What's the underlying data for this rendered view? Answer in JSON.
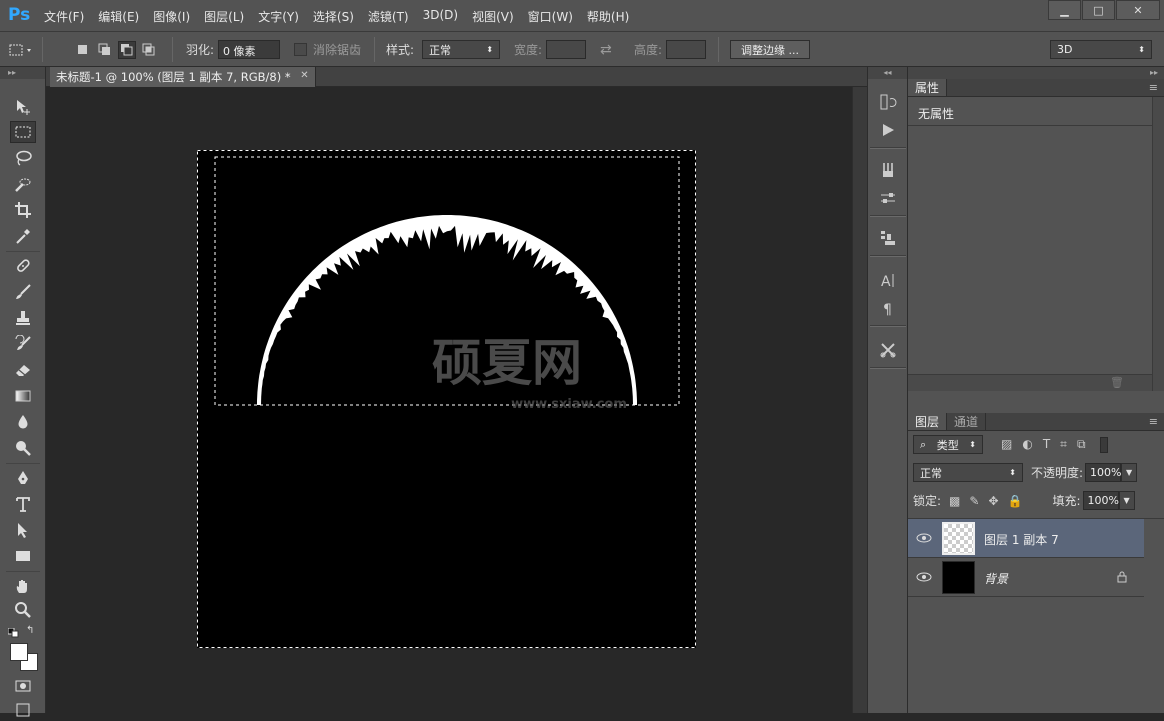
{
  "menubar": {
    "logo": "Ps",
    "items": [
      "文件(F)",
      "编辑(E)",
      "图像(I)",
      "图层(L)",
      "文字(Y)",
      "选择(S)",
      "滤镜(T)",
      "3D(D)",
      "视图(V)",
      "窗口(W)",
      "帮助(H)"
    ],
    "window_controls": [
      "minimize",
      "maximize",
      "close"
    ]
  },
  "options_bar": {
    "feather_label": "羽化:",
    "feather_value": "0 像素",
    "antialias_label": "消除锯齿",
    "style_label": "样式:",
    "style_value": "正常",
    "width_label": "宽度:",
    "height_label": "高度:",
    "refine_edge_button": "调整边缘 ...",
    "workspace_value": "3D"
  },
  "document": {
    "tab_title": "未标题-1 @ 100% (图层 1 副本 7, RGB/8) *"
  },
  "properties_panel": {
    "tab_label": "属性",
    "content": "无属性"
  },
  "layers_panel": {
    "tabs": [
      "图层",
      "通道"
    ],
    "filter_label": "类型",
    "blend_mode": "正常",
    "opacity_label": "不透明度:",
    "opacity_value": "100%",
    "lock_label": "锁定:",
    "fill_label": "填充:",
    "fill_value": "100%",
    "layers": [
      {
        "name": "图层 1 副本 7",
        "selected": true,
        "thumb": "transparent"
      },
      {
        "name": "背景",
        "selected": false,
        "thumb": "black",
        "locked": true
      }
    ]
  },
  "watermark": {
    "text": "硕夏网",
    "url": "www.sxiaw.com"
  }
}
